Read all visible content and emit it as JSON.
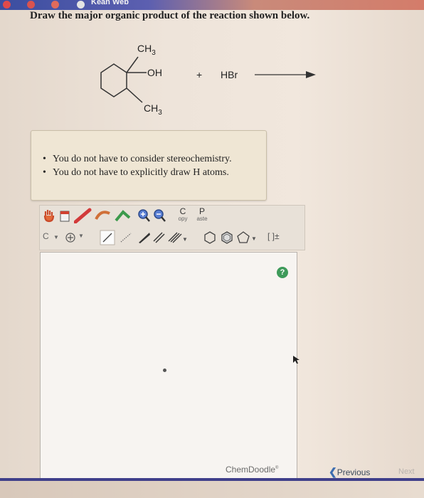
{
  "header": {
    "title_fragment": "Kean Web"
  },
  "question": {
    "text": "Draw the major organic product of the reaction shown below."
  },
  "reaction": {
    "substituent_top": "CH3",
    "substituent_oh": "OH",
    "substituent_bottom": "CH3",
    "plus": "+",
    "reagent": "HBr"
  },
  "hints": {
    "items": [
      "You do not have to consider stereochemistry.",
      "You do not have to explicitly draw H atoms."
    ]
  },
  "toolbar": {
    "copy_top": "C",
    "copy_bottom": "opy",
    "paste_top": "P",
    "paste_bottom": "aste",
    "element_label": "C",
    "bracket_label": "[ ]±"
  },
  "editor": {
    "brand": "ChemDoodle",
    "brand_mark": "®",
    "help": "?"
  },
  "nav": {
    "previous": "Previous",
    "next": "Next"
  }
}
